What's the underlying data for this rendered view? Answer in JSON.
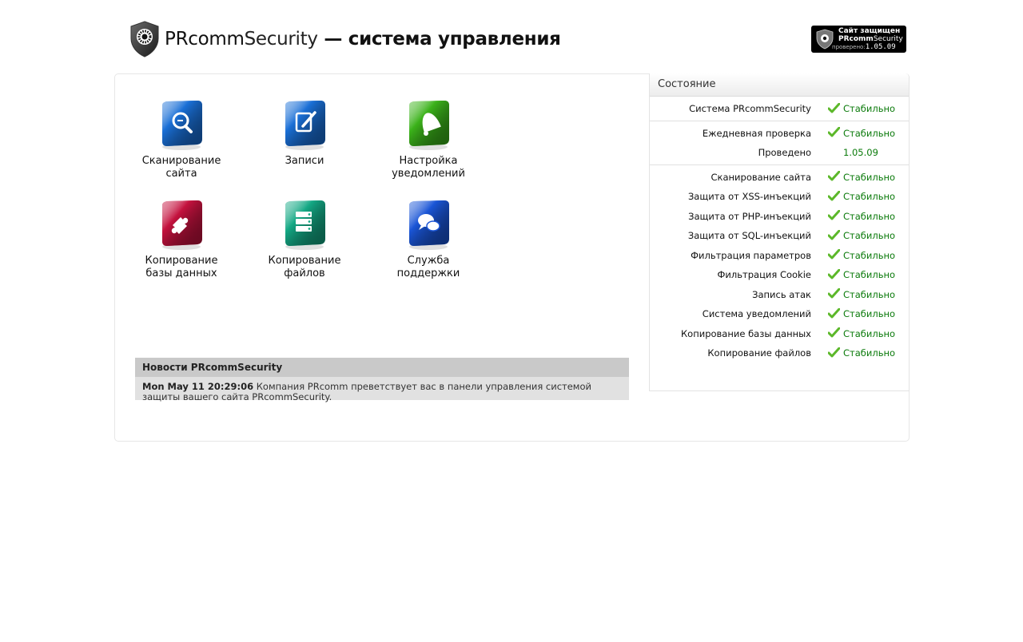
{
  "header": {
    "brand_part1": "PRcomm",
    "brand_part2": "Security",
    "brand_suffix": " — система управления",
    "badge": {
      "line1": "Сайт защищен",
      "line2_bold": "PRcomm",
      "line2_rest": "Security",
      "line3_label": "проверено:",
      "line3_value": "1.05.09"
    }
  },
  "tiles": [
    {
      "label1": "Сканирование",
      "label2": "сайта",
      "icon": "scan-icon",
      "color": "#1a6fd6"
    },
    {
      "label1": "Записи",
      "label2": "",
      "icon": "records-icon",
      "color": "#1a6fd6"
    },
    {
      "label1": "Настройка",
      "label2": "уведомлений",
      "icon": "bell-icon",
      "color": "#3bb21a"
    },
    {
      "label1": "Копирование",
      "label2": "базы данных",
      "icon": "puzzle-icon",
      "color": "#c4123e"
    },
    {
      "label1": "Копирование",
      "label2": "файлов",
      "icon": "server-icon",
      "color": "#14a884"
    },
    {
      "label1": "Служба",
      "label2": "поддержки",
      "icon": "chat-icon",
      "color": "#1a55d6"
    }
  ],
  "news": {
    "title": "Новости PRcommSecurity",
    "date": "Mon May 11 20:29:06",
    "text": " Компания PRcomm преветствует вас в панели управления системой защиты вашего сайта PRcommSecurity."
  },
  "status": {
    "title": "Состояние",
    "groups": [
      [
        {
          "label": "Система PRcommSecurity",
          "value": "Стабильно",
          "check": true
        }
      ],
      [
        {
          "label": "Ежедневная проверка",
          "value": "Стабильно",
          "check": true
        },
        {
          "label": "Проведено",
          "value": "1.05.09",
          "check": false
        }
      ],
      [
        {
          "label": "Сканирование сайта",
          "value": "Стабильно",
          "check": true
        },
        {
          "label": "Защита от XSS-инъекций",
          "value": "Стабильно",
          "check": true
        },
        {
          "label": "Защита от PHP-инъекций",
          "value": "Стабильно",
          "check": true
        },
        {
          "label": "Защита от SQL-инъекций",
          "value": "Стабильно",
          "check": true
        },
        {
          "label": "Фильтрация параметров",
          "value": "Стабильно",
          "check": true
        },
        {
          "label": "Фильтрация Cookie",
          "value": "Стабильно",
          "check": true
        },
        {
          "label": "Запись атак",
          "value": "Стабильно",
          "check": true
        },
        {
          "label": "Система уведомлений",
          "value": "Стабильно",
          "check": true
        },
        {
          "label": "Копирование базы данных",
          "value": "Стабильно",
          "check": true
        },
        {
          "label": "Копирование файлов",
          "value": "Стабильно",
          "check": true
        }
      ]
    ]
  }
}
